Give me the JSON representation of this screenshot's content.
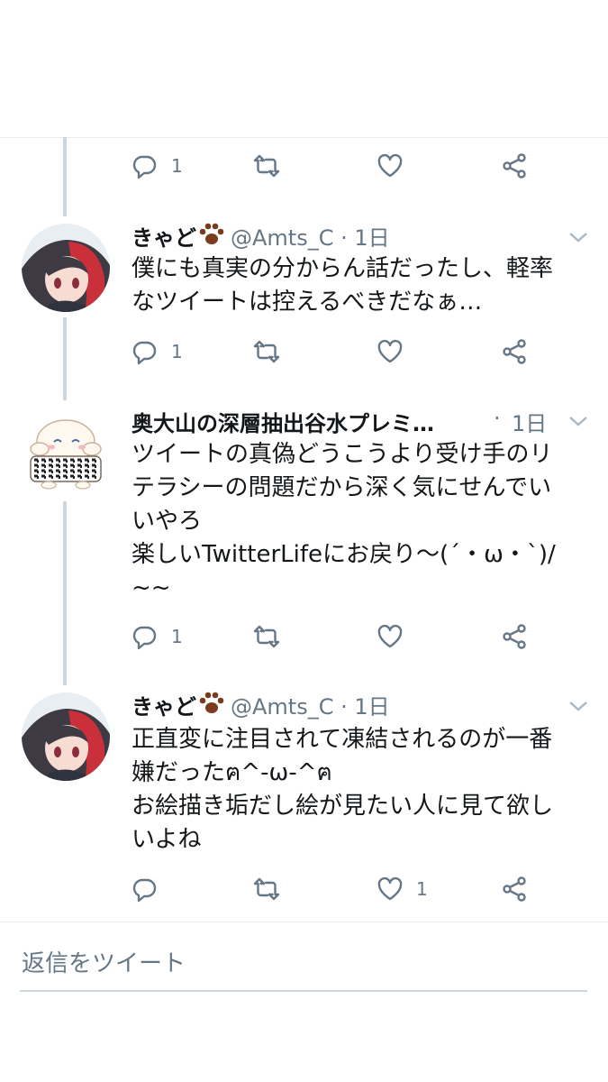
{
  "tweets": [
    {
      "actions": {
        "reply_count": "1",
        "retweet_count": "",
        "like_count": ""
      }
    },
    {
      "author_name": "きゃど",
      "handle": "@Amts_C",
      "separator": "·",
      "time": "1日",
      "lines": [
        "僕にも真実の分からん話だったし、軽率",
        "なツイートは控えるべきだなぁ…"
      ],
      "actions": {
        "reply_count": "1",
        "retweet_count": "",
        "like_count": ""
      }
    },
    {
      "author_name": "奥大山の深層抽出谷水プレミ…",
      "handle": "",
      "separator": "·",
      "time": "1日",
      "lines": [
        "ツイートの真偽どうこうより受け手のリ",
        "テラシーの問題だから深く気にせんでい",
        "いやろ",
        "楽しいTwitterLifeにお戻り〜(´・ω・`)/",
        "~~"
      ],
      "actions": {
        "reply_count": "1",
        "retweet_count": "",
        "like_count": ""
      }
    },
    {
      "author_name": "きゃど",
      "handle": "@Amts_C",
      "separator": "·",
      "time": "1日",
      "lines": [
        "正直変に注目されて凍結されるのが一番",
        "嫌だったฅ^-ω-^ฅ",
        "お絵描き垢だし絵が見たい人に見て欲し",
        "いよね"
      ],
      "actions": {
        "reply_count": "",
        "retweet_count": "",
        "like_count": "1"
      }
    }
  ],
  "reply_box": {
    "placeholder": "返信をツイート"
  },
  "colors": {
    "icon_gray": "#657786",
    "thread_line": "#ccd6dd",
    "paw": "#7b3b1e"
  }
}
